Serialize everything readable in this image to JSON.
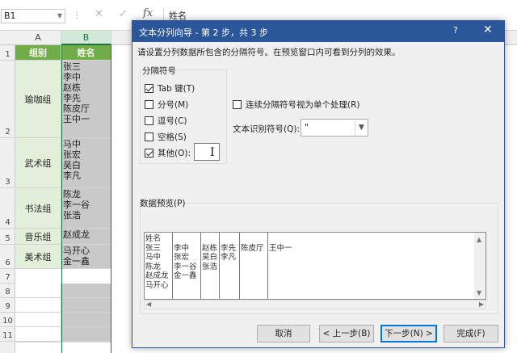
{
  "formula_bar": {
    "name_box": "B1",
    "cancel_glyph": "✕",
    "confirm_glyph": "✓",
    "fx_label": "fx",
    "content": "姓名"
  },
  "columns": [
    "A",
    "B"
  ],
  "rows": [
    "1",
    "2",
    "3",
    "4",
    "5",
    "6",
    "7",
    "8",
    "9",
    "10",
    "11"
  ],
  "table": {
    "headers": [
      "组别",
      "姓名"
    ],
    "groups": [
      {
        "group": "瑜咖组",
        "names": [
          "张三",
          "李中",
          "赵栋",
          "李先",
          "陈皮厅",
          "王中一"
        ]
      },
      {
        "group": "武术组",
        "names": [
          "马中",
          "张宏",
          "吴白",
          "李凡"
        ]
      },
      {
        "group": "书法组",
        "names": [
          "陈龙",
          "李一谷",
          "张浩"
        ]
      },
      {
        "group": "音乐组",
        "names": [
          "赵成龙"
        ]
      },
      {
        "group": "美术组",
        "names": [
          "马开心",
          "金一鑫"
        ]
      }
    ]
  },
  "dialog": {
    "title": "文本分列向导 - 第 2 步，共 3 步",
    "help": "?",
    "close": "✕",
    "instruction": "请设置分列数据所包含的分隔符号。在预览窗口内可看到分列的效果。",
    "delimiters_title": "分隔符号",
    "delimiters": [
      {
        "label": "Tab 键(T)",
        "checked": true
      },
      {
        "label": "分号(M)",
        "checked": false
      },
      {
        "label": "逗号(C)",
        "checked": false
      },
      {
        "label": "空格(S)",
        "checked": false
      },
      {
        "label": "其他(O):",
        "checked": true
      }
    ],
    "treat_consecutive": {
      "label": "连续分隔符号视为单个处理(R)",
      "checked": false
    },
    "text_qualifier_label": "文本识别符号(Q):",
    "text_qualifier_value": "\"",
    "preview_label": "数据预览(P)",
    "preview_columns": [
      [
        "姓名",
        "张三",
        "马中",
        "陈龙",
        "赵成龙",
        "马开心"
      ],
      [
        "",
        "李中",
        "张宏",
        "李一谷",
        "金一鑫"
      ],
      [
        "",
        "赵栋",
        "吴白",
        "张浩"
      ],
      [
        "",
        "李先",
        "李凡"
      ],
      [
        "",
        "陈皮厅"
      ],
      [
        "",
        "王中一"
      ]
    ],
    "buttons": {
      "cancel": "取消",
      "back": "< 上一步(B)",
      "next": "下一步(N) >",
      "finish": "完成(F)"
    }
  },
  "colors": {
    "header_green": "#70ad47",
    "group_fill": "#e2efda",
    "name_fill": "#c9c9c9",
    "dialog_title": "#2b579a"
  }
}
